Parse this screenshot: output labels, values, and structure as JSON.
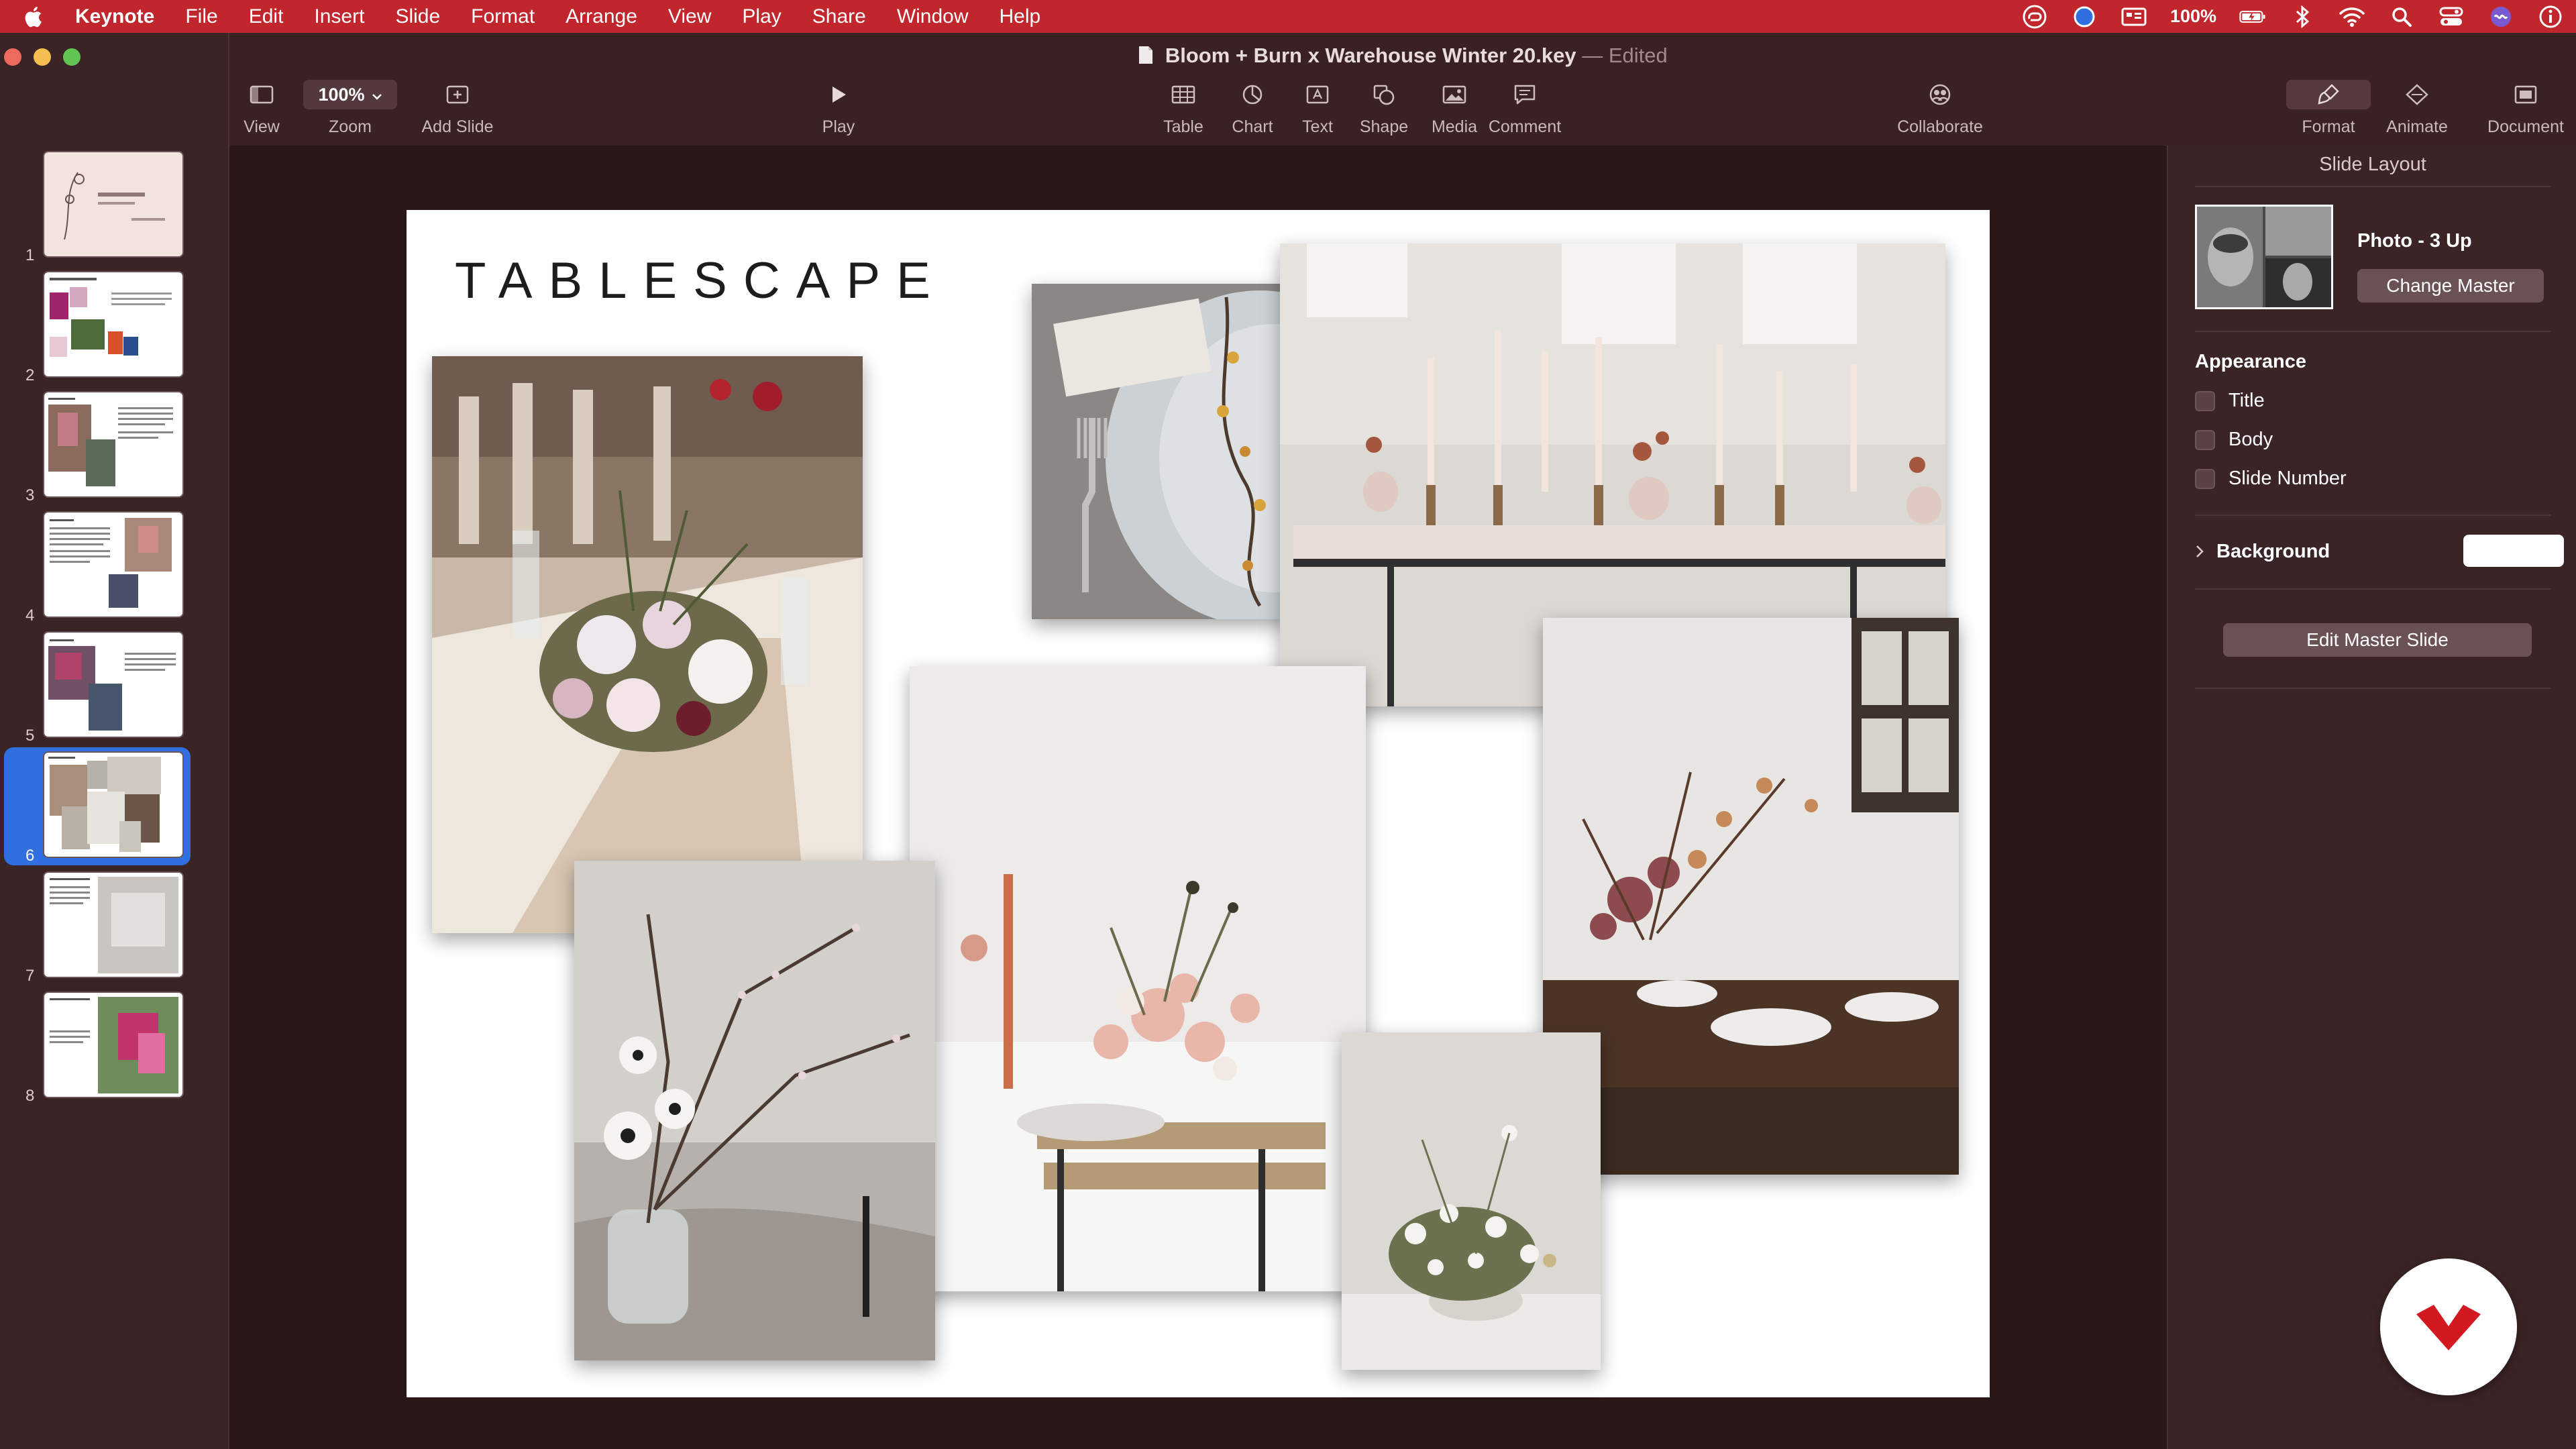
{
  "menubar": {
    "app_name": "Keynote",
    "items": [
      "File",
      "Edit",
      "Insert",
      "Slide",
      "Format",
      "Arrange",
      "View",
      "Play",
      "Share",
      "Window",
      "Help"
    ],
    "battery_percent": "100%"
  },
  "window": {
    "title": "Bloom + Burn x Warehouse Winter 20.key",
    "title_separator": "—",
    "edited_label": "Edited"
  },
  "toolbar": {
    "view_label": "View",
    "zoom_label": "Zoom",
    "zoom_value": "100%",
    "add_slide_label": "Add Slide",
    "play_label": "Play",
    "table_label": "Table",
    "chart_label": "Chart",
    "text_label": "Text",
    "shape_label": "Shape",
    "media_label": "Media",
    "comment_label": "Comment",
    "collaborate_label": "Collaborate",
    "format_label": "Format",
    "animate_label": "Animate",
    "document_label": "Document"
  },
  "navigator": {
    "selected_slide": 6,
    "slides": [
      {
        "number": "1"
      },
      {
        "number": "2"
      },
      {
        "number": "3"
      },
      {
        "number": "4"
      },
      {
        "number": "5"
      },
      {
        "number": "6"
      },
      {
        "number": "7"
      },
      {
        "number": "8"
      }
    ]
  },
  "slide": {
    "title": "TABLESCAPE"
  },
  "inspector": {
    "header": "Slide Layout",
    "layout_name": "Photo - 3 Up",
    "change_master_label": "Change Master",
    "appearance_label": "Appearance",
    "checkboxes": [
      {
        "label": "Title",
        "checked": false
      },
      {
        "label": "Body",
        "checked": false
      },
      {
        "label": "Slide Number",
        "checked": false
      }
    ],
    "background_label": "Background",
    "background_color": "#ffffff",
    "edit_master_label": "Edit Master Slide"
  },
  "colors": {
    "menubar": "#c0262c",
    "chrome": "#3a2224",
    "selection": "#2f6fe0",
    "logo_red": "#d1191f"
  }
}
